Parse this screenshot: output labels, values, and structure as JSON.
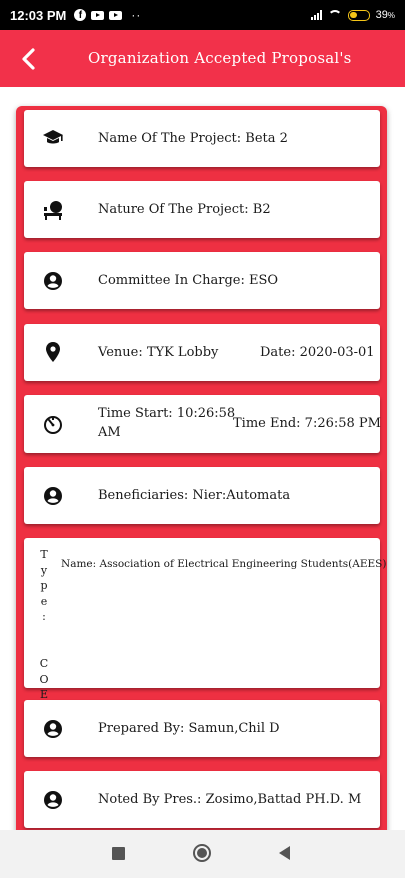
{
  "status_bar": {
    "time": "12:03 PM",
    "facebook_glyph": "f",
    "dots": "··",
    "battery_pct": "39",
    "battery_pct_suffix": "%"
  },
  "app_bar": {
    "title": "Organization Accepted Proposal's",
    "back_icon": "back-arrow-icon"
  },
  "colors": {
    "primary": "#f2314a",
    "panel": "#ee3042",
    "card": "#ffffff"
  },
  "cards": {
    "project_name": {
      "icon": "graduation-cap-icon",
      "text": "Name Of The Project:  Beta 2"
    },
    "project_nature": {
      "icon": "person-at-desk-icon",
      "text": "Nature Of The Project:  B2"
    },
    "committee": {
      "icon": "account-circle-icon",
      "text": "Committee In Charge:  ESO"
    },
    "venue": {
      "icon": "location-pin-icon",
      "text": "Venue:  TYK Lobby",
      "date": "Date:  2020-03-01"
    },
    "time": {
      "icon": "timer-icon",
      "start_line1": "Time Start:  10:26:58",
      "start_line2": "AM",
      "end": "Time End:  7:26:58 PM"
    },
    "beneficiaries": {
      "icon": "account-circle-icon",
      "text": "Beneficiaries:  Nier:Automata"
    },
    "organization": {
      "type_chars": [
        "T",
        "y",
        "p",
        "e",
        ":",
        "",
        "",
        "C",
        "O",
        "E"
      ],
      "name": "Name:  Association of Electrical Engineering Students(AEES)"
    },
    "prepared_by": {
      "icon": "account-circle-icon",
      "text": "Prepared By:  Samun,Chil D"
    },
    "noted_by": {
      "icon": "account-circle-icon",
      "text": "Noted By Pres.:  Zosimo,Battad PH.D. M"
    }
  },
  "nav_bar": {
    "recent": "square-recents-icon",
    "home": "circle-home-icon",
    "back": "triangle-back-icon"
  }
}
